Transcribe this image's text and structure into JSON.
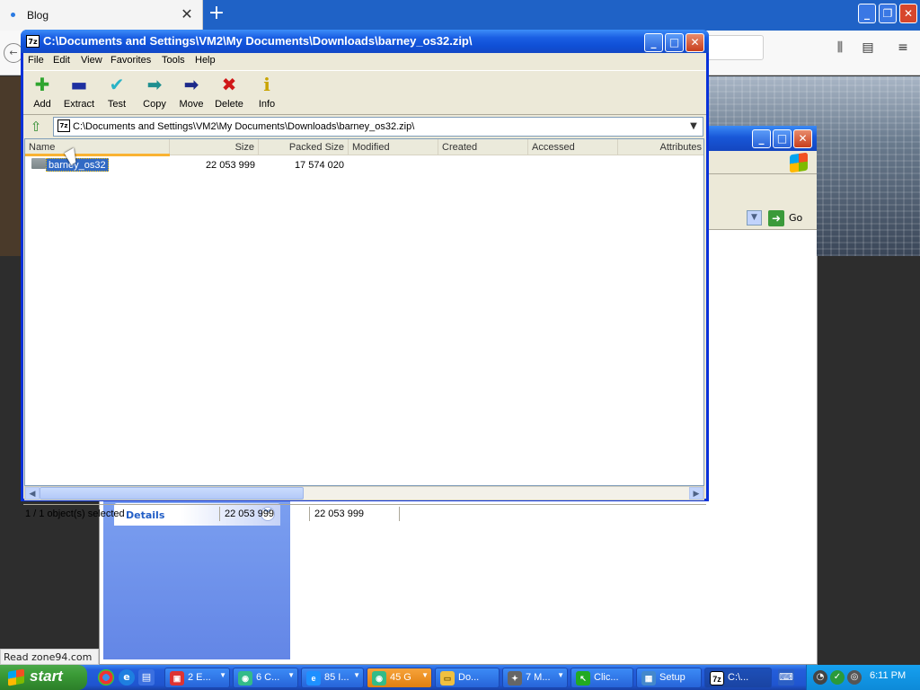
{
  "browser": {
    "tab_title": "Blog",
    "tab_close": "✕",
    "new_tab": "+",
    "status_text": "Read zone94.com"
  },
  "zip_window": {
    "title": "C:\\Documents and Settings\\VM2\\My Documents\\Downloads\\barney_os32.zip\\",
    "app_icon": "7z",
    "menu": [
      "File",
      "Edit",
      "View",
      "Favorites",
      "Tools",
      "Help"
    ],
    "toolbar": [
      {
        "label": "Add",
        "icon": "plus-icon",
        "glyph": "✚",
        "color": "#2fa52f"
      },
      {
        "label": "Extract",
        "icon": "minus-icon",
        "glyph": "▬",
        "color": "#1d2fa0"
      },
      {
        "label": "Test",
        "icon": "check-icon",
        "glyph": "✔",
        "color": "#29b3c6"
      },
      {
        "label": "Copy",
        "icon": "copy-arrow-icon",
        "glyph": "➡",
        "color": "#1e8f8f"
      },
      {
        "label": "Move",
        "icon": "move-arrow-icon",
        "glyph": "➡",
        "color": "#1d2a8a"
      },
      {
        "label": "Delete",
        "icon": "delete-x-icon",
        "glyph": "✖",
        "color": "#d01818"
      },
      {
        "label": "Info",
        "icon": "info-icon",
        "glyph": "i",
        "color": "#c9a400"
      }
    ],
    "address": "C:\\Documents and Settings\\VM2\\My Documents\\Downloads\\barney_os32.zip\\",
    "columns": [
      "Name",
      "Size",
      "Packed Size",
      "Modified",
      "Created",
      "Accessed",
      "Attributes"
    ],
    "rows": [
      {
        "name": "barney_os32",
        "size": "22 053 999",
        "packed_size": "17 574 020",
        "modified": "",
        "created": "",
        "accessed": "",
        "attributes": ""
      }
    ],
    "status": {
      "selection": "1 / 1 object(s) selected",
      "size": "22 053 999",
      "packed": "22 053 999"
    }
  },
  "explorer": {
    "go_label": "Go",
    "details_label": "Details"
  },
  "taskbar": {
    "start_label": "start",
    "tasks": [
      {
        "label": "2 E...",
        "icon": "dev-icon",
        "glyph": "▣",
        "color": "#d33",
        "has_arrow": true
      },
      {
        "label": "6 C...",
        "icon": "chrome-icon",
        "glyph": "◉",
        "color": "#3b8",
        "has_arrow": true
      },
      {
        "label": "85 I...",
        "icon": "ie-icon",
        "glyph": "e",
        "color": "#1e90ff",
        "has_arrow": true
      },
      {
        "label": "45 G",
        "icon": "chrome-icon",
        "glyph": "◉",
        "color": "#3b8",
        "has_arrow": true
      },
      {
        "label": "Do...",
        "icon": "folder-icon",
        "glyph": "▭",
        "color": "#f0c040",
        "has_arrow": false
      },
      {
        "label": "7 M...",
        "icon": "app-icon",
        "glyph": "✦",
        "color": "#666",
        "has_arrow": true
      },
      {
        "label": "Clic...",
        "icon": "click-icon",
        "glyph": "↖",
        "color": "#2a2",
        "has_arrow": false
      },
      {
        "label": "Setup",
        "icon": "setup-icon",
        "glyph": "▦",
        "color": "#48c",
        "has_arrow": false
      },
      {
        "label": "C:\\...",
        "icon": "7zip-icon",
        "glyph": "7z",
        "color": "#fff",
        "has_arrow": false
      }
    ],
    "clock": "6:11 PM"
  }
}
